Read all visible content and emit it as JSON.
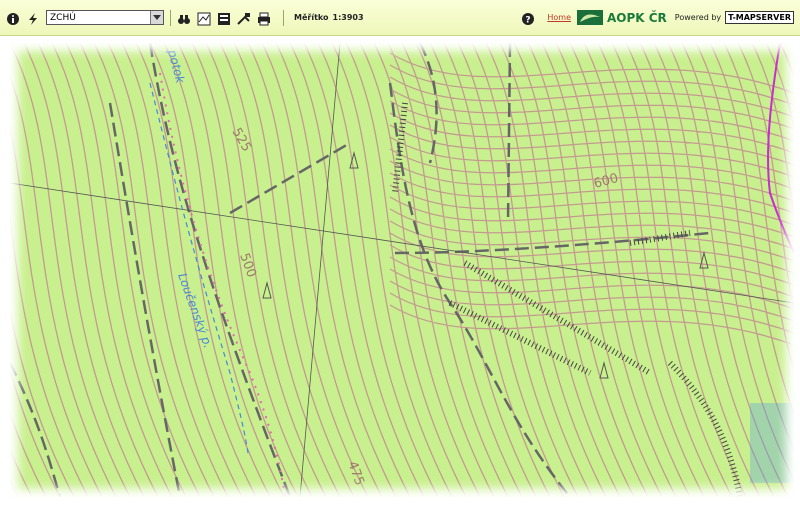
{
  "toolbar": {
    "layer_value": "ZCHÚ",
    "scale_label": "Měřítko",
    "scale_value": "1:3903",
    "home_link": "Home",
    "brand": "AOPK ČR",
    "powered_by": "Powered by",
    "tmap": "T-MAPSERVER"
  },
  "map": {
    "contour_labels": [
      "525",
      "600",
      "500",
      "475"
    ],
    "stream_labels": [
      "potok",
      "Loučenský p."
    ]
  },
  "colors": {
    "map_bg": "#c9f08f",
    "contour": "#c49a90",
    "road": "#666666",
    "trail": "#e36aa8",
    "stream": "#4a86d8"
  }
}
